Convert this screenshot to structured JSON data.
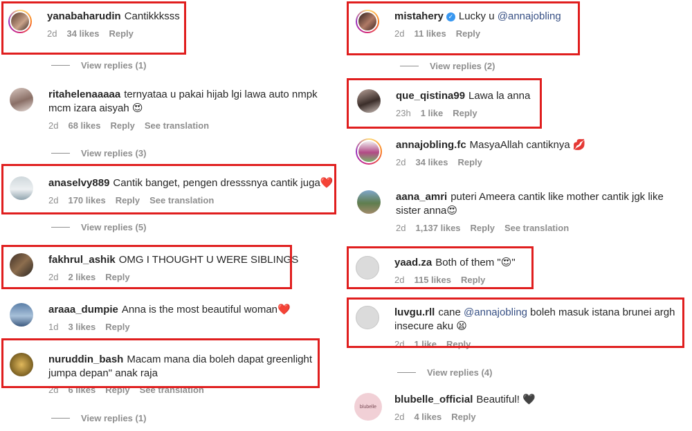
{
  "left": {
    "c1": {
      "user": "yanabaharudin",
      "text": "Cantikkksss",
      "time": "2d",
      "likes": "34 likes",
      "reply": "Reply"
    },
    "v1": "View replies (1)",
    "c2": {
      "user": "ritahelenaaaaa",
      "text": "ternyataa u pakai hijab lgi lawa auto nmpk",
      "text2": "mcm izara aisyah",
      "emoji": "😍",
      "time": "2d",
      "likes": "68 likes",
      "reply": "Reply",
      "trans": "See translation"
    },
    "v2": "View replies (3)",
    "c3": {
      "user": "anaselvy889",
      "text": "Cantik banget, pengen dresssnya cantik juga",
      "emoji": "❤️",
      "time": "2d",
      "likes": "170 likes",
      "reply": "Reply",
      "trans": "See translation"
    },
    "v3": "View replies (5)",
    "c4": {
      "user": "fakhrul_ashik",
      "text": "OMG I THOUGHT U WERE SIBLINGS",
      "time": "2d",
      "likes": "2 likes",
      "reply": "Reply"
    },
    "c5": {
      "user": "araaa_dumpie",
      "text": "Anna is the most beautiful woman",
      "emoji": "❤️",
      "time": "1d",
      "likes": "3 likes",
      "reply": "Reply"
    },
    "c6": {
      "user": "nuruddin_bash",
      "text": "Macam mana dia boleh dapat greenlight",
      "text2": "jumpa depan\" anak raja",
      "time": "2d",
      "likes": "6 likes",
      "reply": "Reply",
      "trans": "See translation"
    },
    "v4": "View replies (1)"
  },
  "right": {
    "c1": {
      "user": "mistahery",
      "text": "Lucky u ",
      "mention": "@annajobling",
      "time": "2d",
      "likes": "11 likes",
      "reply": "Reply"
    },
    "v1": "View replies (2)",
    "c2": {
      "user": "que_qistina99",
      "text": "Lawa la anna",
      "time": "23h",
      "likes": "1 like",
      "reply": "Reply"
    },
    "c3": {
      "user": "annajobling.fc",
      "text": "MasyaAllah cantiknya",
      "emoji": "💋",
      "time": "2d",
      "likes": "34 likes",
      "reply": "Reply"
    },
    "c4": {
      "user": "aana_amri",
      "text": "puteri Ameera cantik like mother cantik jgk like",
      "text2": "sister anna",
      "emoji": "😍",
      "time": "2d",
      "likes": "1,137 likes",
      "reply": "Reply",
      "trans": "See translation"
    },
    "c5": {
      "user": "yaad.za",
      "text": "Both of them \"",
      "emoji": "😍",
      "text_end": "\"",
      "time": "2d",
      "likes": "115 likes",
      "reply": "Reply"
    },
    "c6": {
      "user": "luvgu.rll",
      "text": "cane ",
      "mention": "@annajobling",
      "text_mid": " boleh masuk istana brunei argh",
      "text2": "insecure aku",
      "emoji": "😫",
      "time": "2d",
      "likes": "1 like",
      "reply": "Reply"
    },
    "v2": "View replies (4)",
    "c7": {
      "user": "blubelle_official",
      "text": "Beautiful!",
      "emoji": "🖤",
      "time": "2d",
      "likes": "4 likes",
      "reply": "Reply",
      "avatar_text": "blubelle"
    }
  },
  "colors": {
    "highlight": "#e01e1e",
    "meta": "#8e8e8e",
    "mention": "#385185",
    "verified": "#3897f0"
  }
}
